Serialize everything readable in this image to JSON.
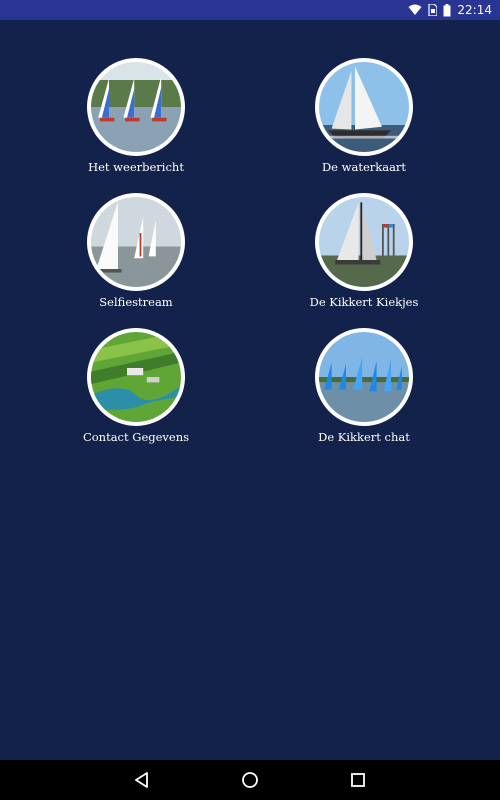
{
  "status_bar": {
    "time": "22:14",
    "icons": [
      "wifi-icon",
      "sim-card-icon",
      "battery-icon"
    ],
    "background_color": "#283593"
  },
  "main": {
    "background_color": "#13224a",
    "tiles": [
      {
        "label": "Het weerbericht",
        "image": "three sailboats with blue and white sails on water"
      },
      {
        "label": "De waterkaart",
        "image": "heeling sailboat with white sail under blue sky"
      },
      {
        "label": "Selfiestream",
        "image": "white sails of dinghies on grey water"
      },
      {
        "label": "De Kikkert Kiekjes",
        "image": "moored sailboat with flags under blue sky"
      },
      {
        "label": "Contact Gegevens",
        "image": "aerial view of green fields and river"
      },
      {
        "label": "De Kikkert chat",
        "image": "fleet of small sailboats with blue sails"
      }
    ]
  },
  "nav_bar": {
    "buttons": [
      "back-icon",
      "home-icon",
      "recents-icon"
    ]
  }
}
